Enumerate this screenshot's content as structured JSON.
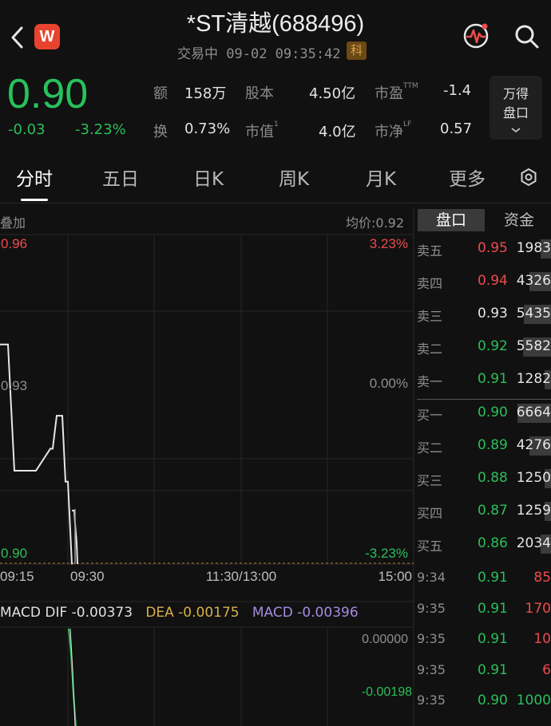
{
  "header": {
    "title": "*ST清越(688496)",
    "status": "交易中",
    "datetime": "09-02 09:35:42",
    "board_badge": "科",
    "logo_letter": "W"
  },
  "quote": {
    "price": "0.90",
    "change": "-0.03",
    "change_pct": "-3.23%",
    "stats": {
      "amount_label": "额",
      "amount_value": "158万",
      "shares_label": "股本",
      "shares_value": "4.50亿",
      "pe_label": "市盈",
      "pe_sup": "TTM",
      "pe_value": "-1.4",
      "turnover_label": "换",
      "turnover_value": "0.73%",
      "mktcap_label": "市值",
      "mktcap_sup": "1",
      "mktcap_value": "4.0亿",
      "pb_label": "市净",
      "pb_sup": "LF",
      "pb_value": "0.57"
    },
    "wande_button": [
      "万得",
      "盘口"
    ]
  },
  "tabs": [
    "分时",
    "五日",
    "日K",
    "周K",
    "月K",
    "更多"
  ],
  "chart": {
    "overlay_label": "叠加",
    "avg_price_label": "均价:0.92",
    "price_high": "0.96",
    "price_mid": "0.93",
    "price_low": "0.90",
    "pct_high": "3.23%",
    "pct_mid": "0.00%",
    "pct_low": "-3.23%",
    "time_labels": [
      "09:15",
      "09:30",
      "11:30/13:00",
      "15:00"
    ]
  },
  "chart_data": {
    "type": "line",
    "x": [
      "09:15",
      "09:17",
      "09:19",
      "09:21",
      "09:23",
      "09:25",
      "09:26",
      "09:27",
      "09:28",
      "09:29",
      "09:30",
      "09:31"
    ],
    "series": [
      {
        "values": [
          0.94,
          0.94,
          0.917,
          0.917,
          0.917,
          0.921,
          0.921,
          0.927,
          0.927,
          0.915,
          0.915,
          0.9
        ]
      }
    ],
    "ylim": [
      0.9,
      0.96
    ],
    "grid": true
  },
  "order_book": {
    "tab_book": "盘口",
    "tab_funds": "资金",
    "asks": [
      {
        "label": "卖五",
        "price": "0.95",
        "volume": "1983",
        "color": "#ee4b4b",
        "fill": 0.3
      },
      {
        "label": "卖四",
        "price": "0.94",
        "volume": "4326",
        "color": "#ee4b4b",
        "fill": 0.65
      },
      {
        "label": "卖三",
        "price": "0.93",
        "volume": "5435",
        "color": "#e6e6e6",
        "fill": 0.82
      },
      {
        "label": "卖二",
        "price": "0.92",
        "volume": "5582",
        "color": "#2bbf5a",
        "fill": 0.84
      },
      {
        "label": "卖一",
        "price": "0.91",
        "volume": "1282",
        "color": "#2bbf5a",
        "fill": 0.19
      }
    ],
    "bids": [
      {
        "label": "买一",
        "price": "0.90",
        "volume": "6664",
        "color": "#2bbf5a",
        "fill": 1.0
      },
      {
        "label": "买二",
        "price": "0.89",
        "volume": "4276",
        "color": "#2bbf5a",
        "fill": 0.64
      },
      {
        "label": "买三",
        "price": "0.88",
        "volume": "1250",
        "color": "#2bbf5a",
        "fill": 0.19
      },
      {
        "label": "买四",
        "price": "0.87",
        "volume": "1259",
        "color": "#2bbf5a",
        "fill": 0.19
      },
      {
        "label": "买五",
        "price": "0.86",
        "volume": "2034",
        "color": "#2bbf5a",
        "fill": 0.31
      }
    ]
  },
  "ticks": [
    {
      "time": "9:34",
      "price": "0.91",
      "volume": "85",
      "pcolor": "#2bbf5a",
      "vcolor": "#ee4b4b"
    },
    {
      "time": "9:35",
      "price": "0.91",
      "volume": "170",
      "pcolor": "#2bbf5a",
      "vcolor": "#ee4b4b"
    },
    {
      "time": "9:35",
      "price": "0.91",
      "volume": "10",
      "pcolor": "#2bbf5a",
      "vcolor": "#ee4b4b"
    },
    {
      "time": "9:35",
      "price": "0.91",
      "volume": "6",
      "pcolor": "#2bbf5a",
      "vcolor": "#ee4b4b"
    },
    {
      "time": "9:35",
      "price": "0.90",
      "volume": "1000",
      "pcolor": "#2bbf5a",
      "vcolor": "#2bbf5a"
    }
  ],
  "macd": {
    "dif_label": "MACD DIF -0.00373",
    "dea_label": "DEA -0.00175",
    "macd_label": "MACD -0.00396",
    "axis_top": "0.00000",
    "axis_low": "-0.00198",
    "colors": {
      "dif": "#e0e0e0",
      "dea": "#d8b04a",
      "macd": "#a58be0"
    }
  }
}
